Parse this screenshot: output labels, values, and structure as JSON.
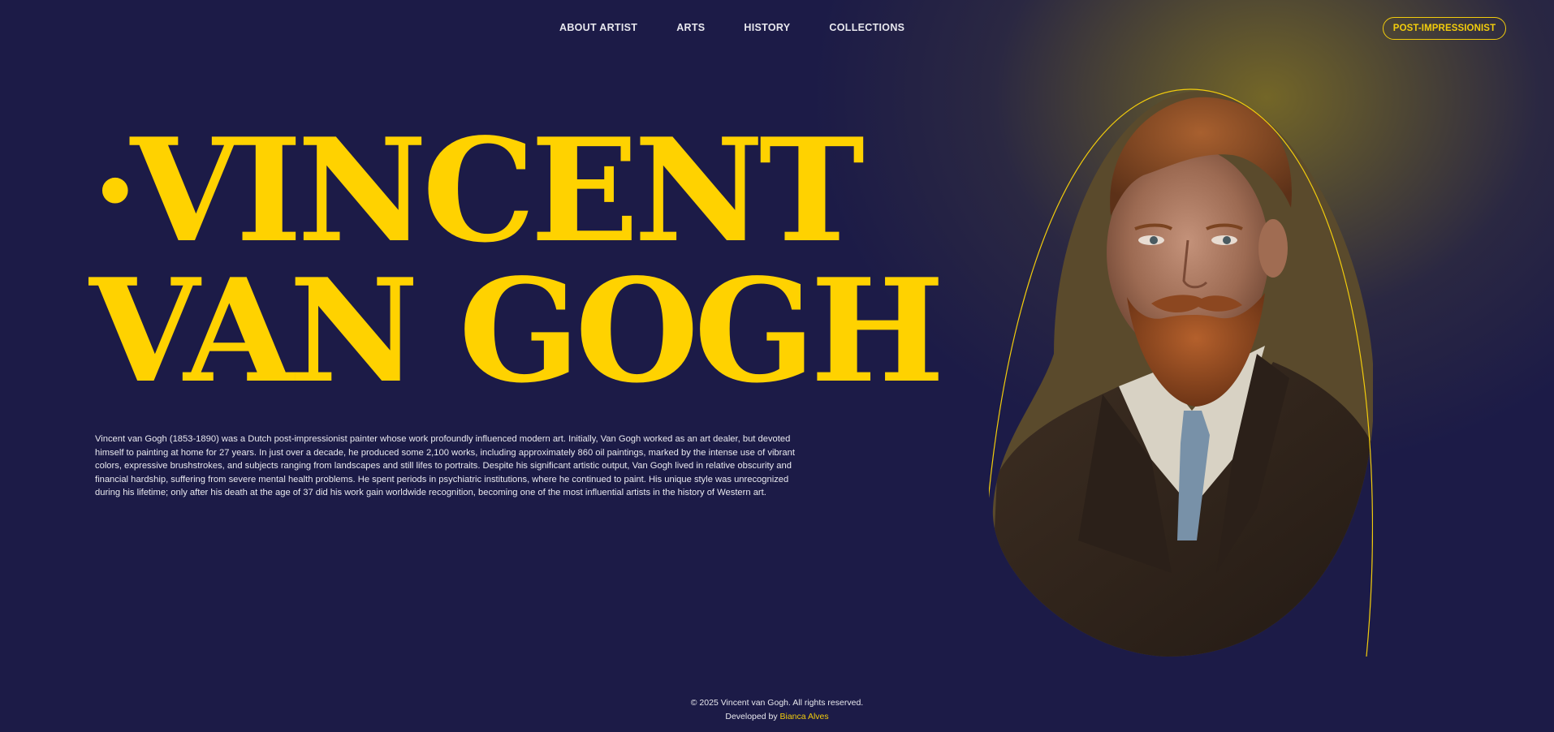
{
  "nav": {
    "items": [
      {
        "label": "ABOUT ARTIST"
      },
      {
        "label": "ARTS"
      },
      {
        "label": "HISTORY"
      },
      {
        "label": "COLLECTIONS"
      }
    ],
    "tag_button": "POST-IMPRESSIONIST"
  },
  "hero": {
    "bullet": "•",
    "line1": "VINCENT",
    "line2": "VAN GOGH",
    "bio": "Vincent van Gogh (1853-1890) was a Dutch post-impressionist painter whose work profoundly influenced modern art. Initially, Van Gogh worked as an art dealer, but devoted himself to painting at home for 27 years. In just over a decade, he produced some 2,100 works, including approximately 860 oil paintings, marked by the intense use of vibrant colors, expressive brushstrokes, and subjects ranging from landscapes and still lifes to portraits. Despite his significant artistic output, Van Gogh lived in relative obscurity and financial hardship, suffering from severe mental health problems. He spent periods in psychiatric institutions, where he continued to paint. His unique style was unrecognized during his lifetime; only after his death at the age of 37 did his work gain worldwide recognition, becoming one of the most influential artists in the history of Western art."
  },
  "footer": {
    "copyright": "© 2025 Vincent van Gogh. All rights reserved.",
    "developed_by": "Developed by",
    "developer": "Bianca Alves"
  },
  "colors": {
    "background": "#1c1b47",
    "accent": "#ffd200",
    "text": "#e9e9ef"
  },
  "icons": {
    "portrait": "portrait-image"
  }
}
